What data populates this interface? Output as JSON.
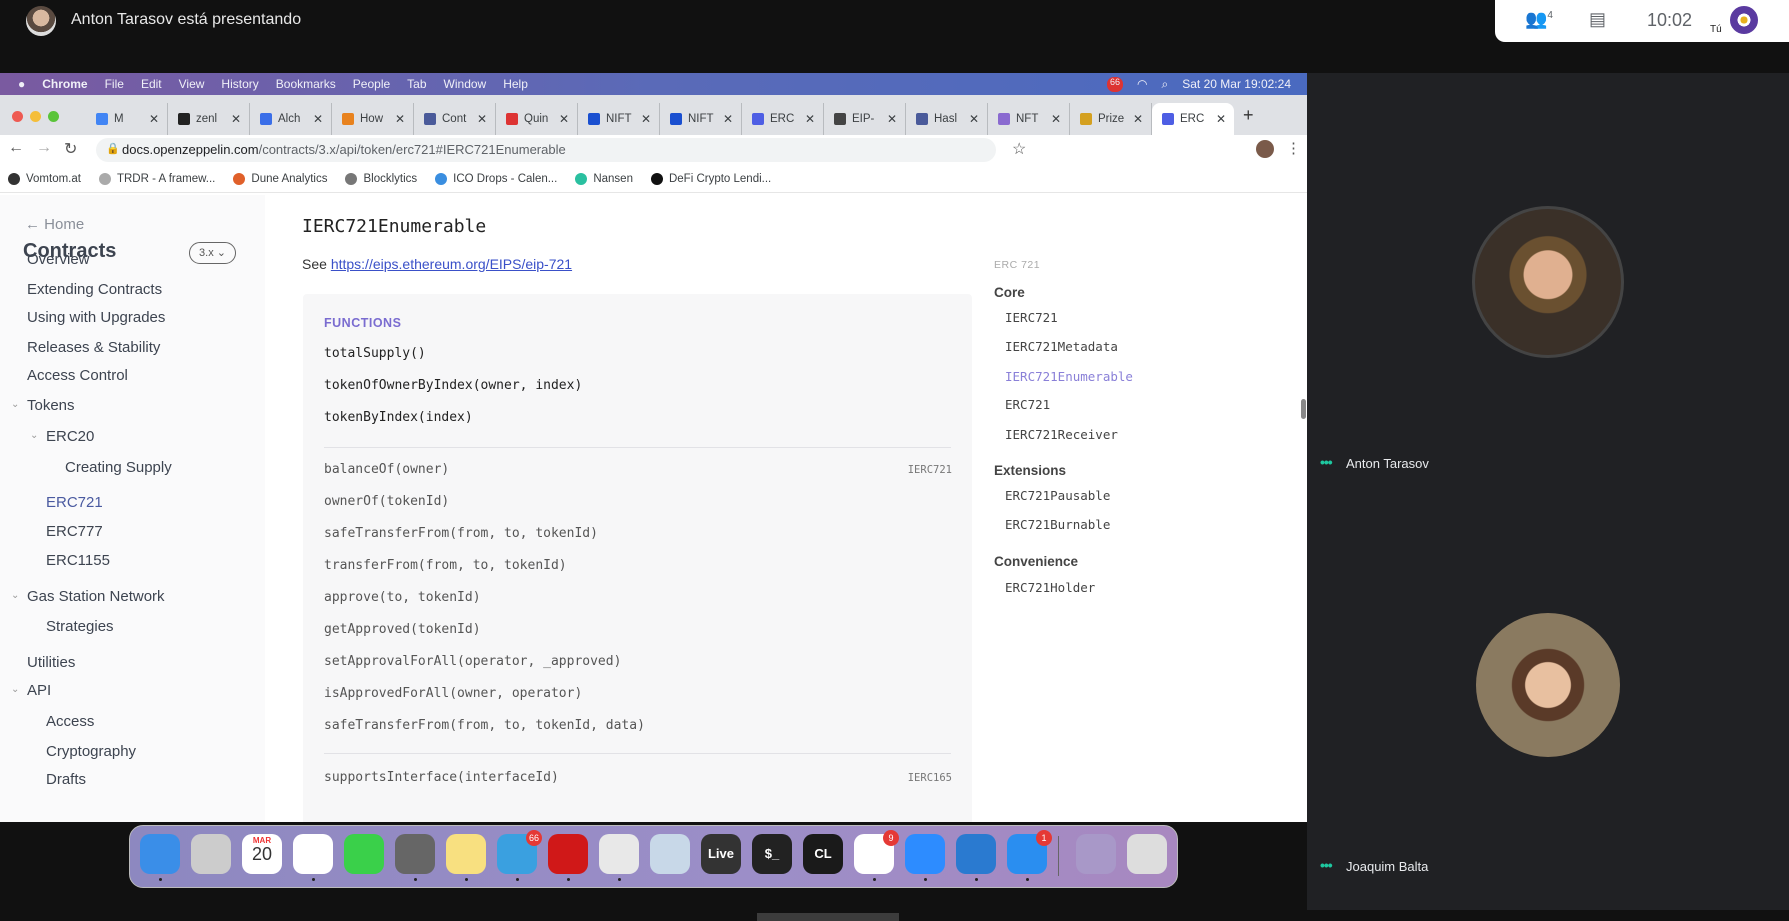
{
  "meet": {
    "presenting_text": "Anton Tarasov está presentando",
    "people_count": "4",
    "time": "10:02",
    "self_label": "Tú",
    "participants": [
      {
        "name": "Anton Tarasov"
      },
      {
        "name": "Joaquim Balta"
      }
    ],
    "accent": "#1ec8a0"
  },
  "menubar": {
    "items": [
      "Chrome",
      "File",
      "Edit",
      "View",
      "History",
      "Bookmarks",
      "People",
      "Tab",
      "Window",
      "Help"
    ],
    "datetime": "Sat 20 Mar  19:02:24",
    "notif_badge": "66"
  },
  "tabs": [
    {
      "label": "M",
      "color": "#4285f4"
    },
    {
      "label": "zenl",
      "color": "#222"
    },
    {
      "label": "Alch",
      "color": "#3a6ee8"
    },
    {
      "label": "How",
      "color": "#e8821e"
    },
    {
      "label": "Cont",
      "color": "#4a5a9a"
    },
    {
      "label": "Quin",
      "color": "#d33"
    },
    {
      "label": "NIFT",
      "color": "#1a4fd0"
    },
    {
      "label": "NIFT",
      "color": "#1a4fd0"
    },
    {
      "label": "ERC",
      "color": "#4e5ee4"
    },
    {
      "label": "EIP-",
      "color": "#444"
    },
    {
      "label": "Hasl",
      "color": "#4a5a9a"
    },
    {
      "label": "NFT",
      "color": "#8a6ad0"
    },
    {
      "label": "Prize",
      "color": "#d4a020"
    },
    {
      "label": "ERC",
      "color": "#4e5ee4",
      "active": true
    }
  ],
  "address": {
    "host": "docs.openzeppelin.com",
    "path": "/contracts/3.x/api/token/erc721#IERC721Enumerable"
  },
  "bookmarks": [
    {
      "label": "Vomtom.at",
      "color": "#333"
    },
    {
      "label": "TRDR - A framew...",
      "color": "#aaa"
    },
    {
      "label": "Dune Analytics",
      "color": "#e0602a"
    },
    {
      "label": "Blocklytics",
      "color": "#777"
    },
    {
      "label": "ICO Drops - Calen...",
      "color": "#3a8ee0"
    },
    {
      "label": "Nansen",
      "color": "#2ac0a0"
    },
    {
      "label": "DeFi Crypto Lendi...",
      "color": "#111"
    }
  ],
  "sidebar": {
    "home": "← Home",
    "title": "Contracts",
    "version": "3.x ⌄",
    "items": [
      {
        "label": "Overview",
        "level": 0
      },
      {
        "label": "Extending Contracts",
        "level": 0
      },
      {
        "label": "Using with Upgrades",
        "level": 0
      },
      {
        "label": "Releases & Stability",
        "level": 0
      },
      {
        "label": "Access Control",
        "level": 0
      },
      {
        "label": "Tokens",
        "level": 0,
        "expanded": true
      },
      {
        "label": "ERC20",
        "level": 1,
        "expanded": true
      },
      {
        "label": "Creating Supply",
        "level": 2
      },
      {
        "label": "ERC721",
        "level": 1,
        "active": true
      },
      {
        "label": "ERC777",
        "level": 1
      },
      {
        "label": "ERC1155",
        "level": 1
      },
      {
        "label": "Gas Station Network",
        "level": 0,
        "expanded": true
      },
      {
        "label": "Strategies",
        "level": 1
      },
      {
        "label": "Utilities",
        "level": 0
      },
      {
        "label": "API",
        "level": 0,
        "expanded": true
      },
      {
        "label": "Access",
        "level": 1
      },
      {
        "label": "Cryptography",
        "level": 1
      },
      {
        "label": "Drafts",
        "level": 1
      }
    ]
  },
  "main": {
    "title": "IERC721Enumerable",
    "see_label": "See",
    "see_link": "https://eips.ethereum.org/EIPS/eip-721",
    "functions_heading": "FUNCTIONS",
    "groups": [
      {
        "tag": "",
        "items": [
          "totalSupply()",
          "tokenOfOwnerByIndex(owner, index)",
          "tokenByIndex(index)"
        ]
      },
      {
        "tag": "IERC721",
        "items": [
          "balanceOf(owner)",
          "ownerOf(tokenId)",
          "safeTransferFrom(from, to, tokenId)",
          "transferFrom(from, to, tokenId)",
          "approve(to, tokenId)",
          "getApproved(tokenId)",
          "setApprovalForAll(operator, _approved)",
          "isApprovedForAll(owner, operator)",
          "safeTransferFrom(from, to, tokenId, data)"
        ]
      },
      {
        "tag": "IERC165",
        "items": [
          "supportsInterface(interfaceId)"
        ]
      }
    ]
  },
  "toc": {
    "heading": "ERC 721",
    "sections": [
      {
        "title": "Core",
        "items": [
          "IERC721",
          "IERC721Metadata",
          "IERC721Enumerable",
          "ERC721",
          "IERC721Receiver"
        ],
        "active": "IERC721Enumerable"
      },
      {
        "title": "Extensions",
        "items": [
          "ERC721Pausable",
          "ERC721Burnable"
        ]
      },
      {
        "title": "Convenience",
        "items": [
          "ERC721Holder"
        ]
      }
    ]
  },
  "dock": [
    {
      "name": "finder",
      "color": "#3a8ee8",
      "run": true
    },
    {
      "name": "launchpad",
      "color": "#ccc"
    },
    {
      "name": "calendar",
      "color": "#fff",
      "text": "20",
      "month": "MAR"
    },
    {
      "name": "reminders",
      "color": "#fff",
      "run": true
    },
    {
      "name": "messages",
      "color": "#3ad04a"
    },
    {
      "name": "system-preferences",
      "color": "#666",
      "run": true
    },
    {
      "name": "notes",
      "color": "#f8e080",
      "run": true
    },
    {
      "name": "telegram",
      "color": "#3aa0e0",
      "badge": "66",
      "run": true
    },
    {
      "name": "opera",
      "color": "#d01818",
      "run": true
    },
    {
      "name": "chrome",
      "color": "#e8e8e8",
      "run": true
    },
    {
      "name": "preview",
      "color": "#c8d8e8"
    },
    {
      "name": "live",
      "color": "#333",
      "text": "Live"
    },
    {
      "name": "terminal",
      "color": "#222",
      "text": "$_"
    },
    {
      "name": "clion",
      "color": "#1a1a1a",
      "text": "CL"
    },
    {
      "name": "slack",
      "color": "#fff",
      "badge": "9",
      "run": true
    },
    {
      "name": "zoom",
      "color": "#2d8cff",
      "run": true
    },
    {
      "name": "vscode",
      "color": "#2a7ad0",
      "run": true
    },
    {
      "name": "app-store",
      "color": "#2a8ef0",
      "badge": "1",
      "run": true
    },
    {
      "name": "downloads",
      "color": "#a898c8"
    },
    {
      "name": "trash",
      "color": "#ddd"
    }
  ]
}
